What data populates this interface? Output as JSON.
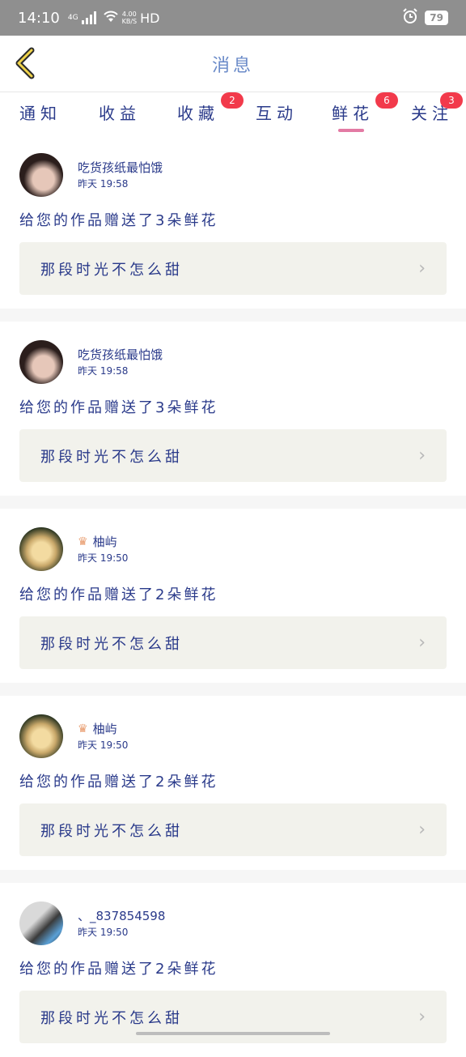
{
  "status_bar": {
    "time": "14:10",
    "network": "4G",
    "speed_value": "4.00",
    "speed_unit": "KB/S",
    "hd": "HD",
    "battery": "79"
  },
  "header": {
    "title": "消息"
  },
  "tabs": [
    {
      "label": "通知",
      "badge": ""
    },
    {
      "label": "收益",
      "badge": ""
    },
    {
      "label": "收藏",
      "badge": "2"
    },
    {
      "label": "互动",
      "badge": ""
    },
    {
      "label": "鲜花",
      "badge": "6",
      "active": true
    },
    {
      "label": "关注",
      "badge": "3"
    }
  ],
  "messages": [
    {
      "user": "吃货孩纸最怕饿",
      "time": "昨天 19:58",
      "text": "给您的作品赠送了3朵鲜花",
      "work": "那段时光不怎么甜",
      "avatar": "girl",
      "vip": false
    },
    {
      "user": "吃货孩纸最怕饿",
      "time": "昨天 19:58",
      "text": "给您的作品赠送了3朵鲜花",
      "work": "那段时光不怎么甜",
      "avatar": "girl",
      "vip": false
    },
    {
      "user": "柚屿",
      "time": "昨天 19:50",
      "text": "给您的作品赠送了2朵鲜花",
      "work": "那段时光不怎么甜",
      "avatar": "heart",
      "vip": true
    },
    {
      "user": "柚屿",
      "time": "昨天 19:50",
      "text": "给您的作品赠送了2朵鲜花",
      "work": "那段时光不怎么甜",
      "avatar": "heart",
      "vip": true
    },
    {
      "user": "、_837854598",
      "time": "昨天 19:50",
      "text": "给您的作品赠送了2朵鲜花",
      "work": "那段时光不怎么甜",
      "avatar": "boy",
      "vip": false
    }
  ]
}
